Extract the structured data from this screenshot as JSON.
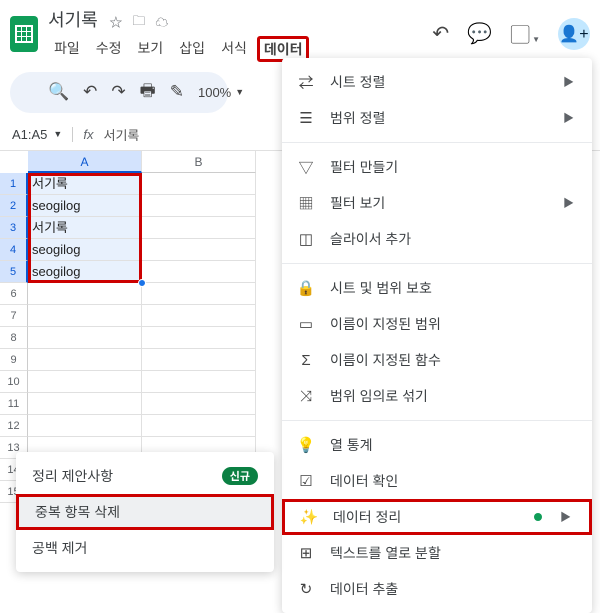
{
  "header": {
    "doc_title": "서기록",
    "menus": [
      "파일",
      "수정",
      "보기",
      "삽입",
      "서식",
      "데이터"
    ],
    "active_menu_index": 5
  },
  "toolbar": {
    "zoom": "100%"
  },
  "name_box": {
    "range": "A1:A5",
    "formula_display": "서기록"
  },
  "grid": {
    "columns": [
      "A",
      "B"
    ],
    "selected_columns": [
      "A"
    ],
    "rows": [
      1,
      2,
      3,
      4,
      5,
      6,
      7,
      8,
      9,
      10,
      11,
      12,
      13,
      14,
      15
    ],
    "selected_rows": [
      1,
      2,
      3,
      4,
      5
    ],
    "cells": {
      "A1": "서기록",
      "A2": "seogilog",
      "A3": "서기록",
      "A4": "seogilog",
      "A5": "seogilog"
    }
  },
  "data_menu": {
    "items": [
      {
        "icon": "sort-sheet",
        "label": "시트 정렬",
        "submenu": true
      },
      {
        "icon": "sort-range",
        "label": "범위 정렬",
        "submenu": true
      },
      {
        "sep": true
      },
      {
        "icon": "filter",
        "label": "필터 만들기"
      },
      {
        "icon": "filter-views",
        "label": "필터 보기",
        "submenu": true
      },
      {
        "icon": "slicer",
        "label": "슬라이서 추가"
      },
      {
        "sep": true
      },
      {
        "icon": "protect",
        "label": "시트 및 범위 보호"
      },
      {
        "icon": "named-range",
        "label": "이름이 지정된 범위"
      },
      {
        "icon": "named-fn",
        "label": "이름이 지정된 함수"
      },
      {
        "icon": "randomize",
        "label": "범위 임의로 섞기"
      },
      {
        "sep": true
      },
      {
        "icon": "column-stats",
        "label": "열 통계"
      },
      {
        "icon": "validation",
        "label": "데이터 확인"
      },
      {
        "icon": "cleanup",
        "label": "데이터 정리",
        "submenu": true,
        "dot": true,
        "highlight": true
      },
      {
        "icon": "split-text",
        "label": "텍스트를 열로 분할"
      },
      {
        "icon": "extract",
        "label": "데이터 추출"
      }
    ]
  },
  "cleanup_submenu": {
    "items": [
      {
        "label": "정리 제안사항",
        "new": true
      },
      {
        "label": "중복 항목 삭제",
        "highlight": true
      },
      {
        "label": "공백 제거"
      }
    ],
    "new_badge": "신규"
  }
}
